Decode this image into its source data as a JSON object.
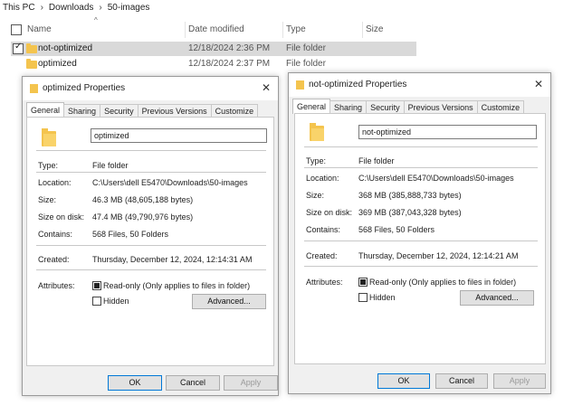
{
  "breadcrumb": [
    "This PC",
    "Downloads",
    "50-images"
  ],
  "columns": {
    "name": "Name",
    "date": "Date modified",
    "type": "Type",
    "size": "Size"
  },
  "rows": [
    {
      "name": "not-optimized",
      "date": "12/18/2024 2:36 PM",
      "type": "File folder"
    },
    {
      "name": "optimized",
      "date": "12/18/2024 2:37 PM",
      "type": "File folder"
    }
  ],
  "dialog_left": {
    "title": "optimized Properties",
    "tabs": [
      "General",
      "Sharing",
      "Security",
      "Previous Versions",
      "Customize"
    ],
    "name": "optimized",
    "labels": {
      "type": "Type:",
      "location": "Location:",
      "size": "Size:",
      "size_on_disk": "Size on disk:",
      "contains": "Contains:",
      "created": "Created:",
      "attributes": "Attributes:"
    },
    "values": {
      "type": "File folder",
      "location": "C:\\Users\\dell E5470\\Downloads\\50-images",
      "size": "46.3 MB (48,605,188 bytes)",
      "size_on_disk": "47.4 MB (49,790,976 bytes)",
      "contains": "568 Files, 50 Folders",
      "created": "Thursday, December 12, 2024, 12:14:31 AM"
    },
    "readonly": "Read-only (Only applies to files in folder)",
    "hidden": "Hidden",
    "advanced": "Advanced...",
    "ok": "OK",
    "cancel": "Cancel",
    "apply": "Apply"
  },
  "dialog_right": {
    "title": "not-optimized Properties",
    "tabs": [
      "General",
      "Sharing",
      "Security",
      "Previous Versions",
      "Customize"
    ],
    "name": "not-optimized",
    "labels": {
      "type": "Type:",
      "location": "Location:",
      "size": "Size:",
      "size_on_disk": "Size on disk:",
      "contains": "Contains:",
      "created": "Created:",
      "attributes": "Attributes:"
    },
    "values": {
      "type": "File folder",
      "location": "C:\\Users\\dell E5470\\Downloads\\50-images",
      "size": "368 MB (385,888,733 bytes)",
      "size_on_disk": "369 MB (387,043,328 bytes)",
      "contains": "568 Files, 50 Folders",
      "created": "Thursday, December 12, 2024, 12:14:21 AM"
    },
    "readonly": "Read-only (Only applies to files in folder)",
    "hidden": "Hidden",
    "advanced": "Advanced...",
    "ok": "OK",
    "cancel": "Cancel",
    "apply": "Apply"
  }
}
